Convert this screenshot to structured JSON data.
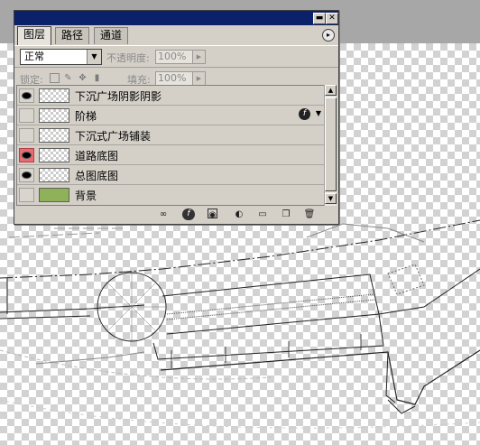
{
  "palette": {
    "titlebar": {
      "minimize_glyph": "▬",
      "close_glyph": "✕"
    },
    "tabs": [
      {
        "label": "图层",
        "active": true
      },
      {
        "label": "路径",
        "active": false
      },
      {
        "label": "通道",
        "active": false
      }
    ],
    "menu_glyph": "▸",
    "blend_mode": {
      "value": "正常"
    },
    "opacity": {
      "label": "不透明度:",
      "value": "100%"
    },
    "lock": {
      "label": "锁定:"
    },
    "fill": {
      "label": "填充:",
      "value": "100%"
    },
    "layers": [
      {
        "name": "下沉广场阴影阴影",
        "visible": true,
        "eye_color": "",
        "thumb": "checker",
        "fx": false
      },
      {
        "name": "阶梯",
        "visible": false,
        "eye_color": "",
        "thumb": "checker",
        "fx": true
      },
      {
        "name": "下沉式广场铺装",
        "visible": false,
        "eye_color": "",
        "thumb": "checker",
        "fx": false
      },
      {
        "name": "道路底图",
        "visible": true,
        "eye_color": "#e96a72",
        "thumb": "checker",
        "fx": false
      },
      {
        "name": "总图底图",
        "visible": true,
        "eye_color": "",
        "thumb": "checker",
        "fx": false
      },
      {
        "name": "背景",
        "visible": false,
        "eye_color": "",
        "thumb": "green",
        "fx": false
      }
    ],
    "bottom_icons": [
      "link-icon",
      "layer-style-icon",
      "mask-icon",
      "adjustment-icon",
      "group-folder-icon",
      "new-layer-icon",
      "trash-icon"
    ]
  },
  "colors": {
    "titlebar": "#0b2169",
    "panel": "#d4d0c8",
    "canvas_bg": "#a7a7a7",
    "background_layer_thumb": "#8fb15a"
  }
}
